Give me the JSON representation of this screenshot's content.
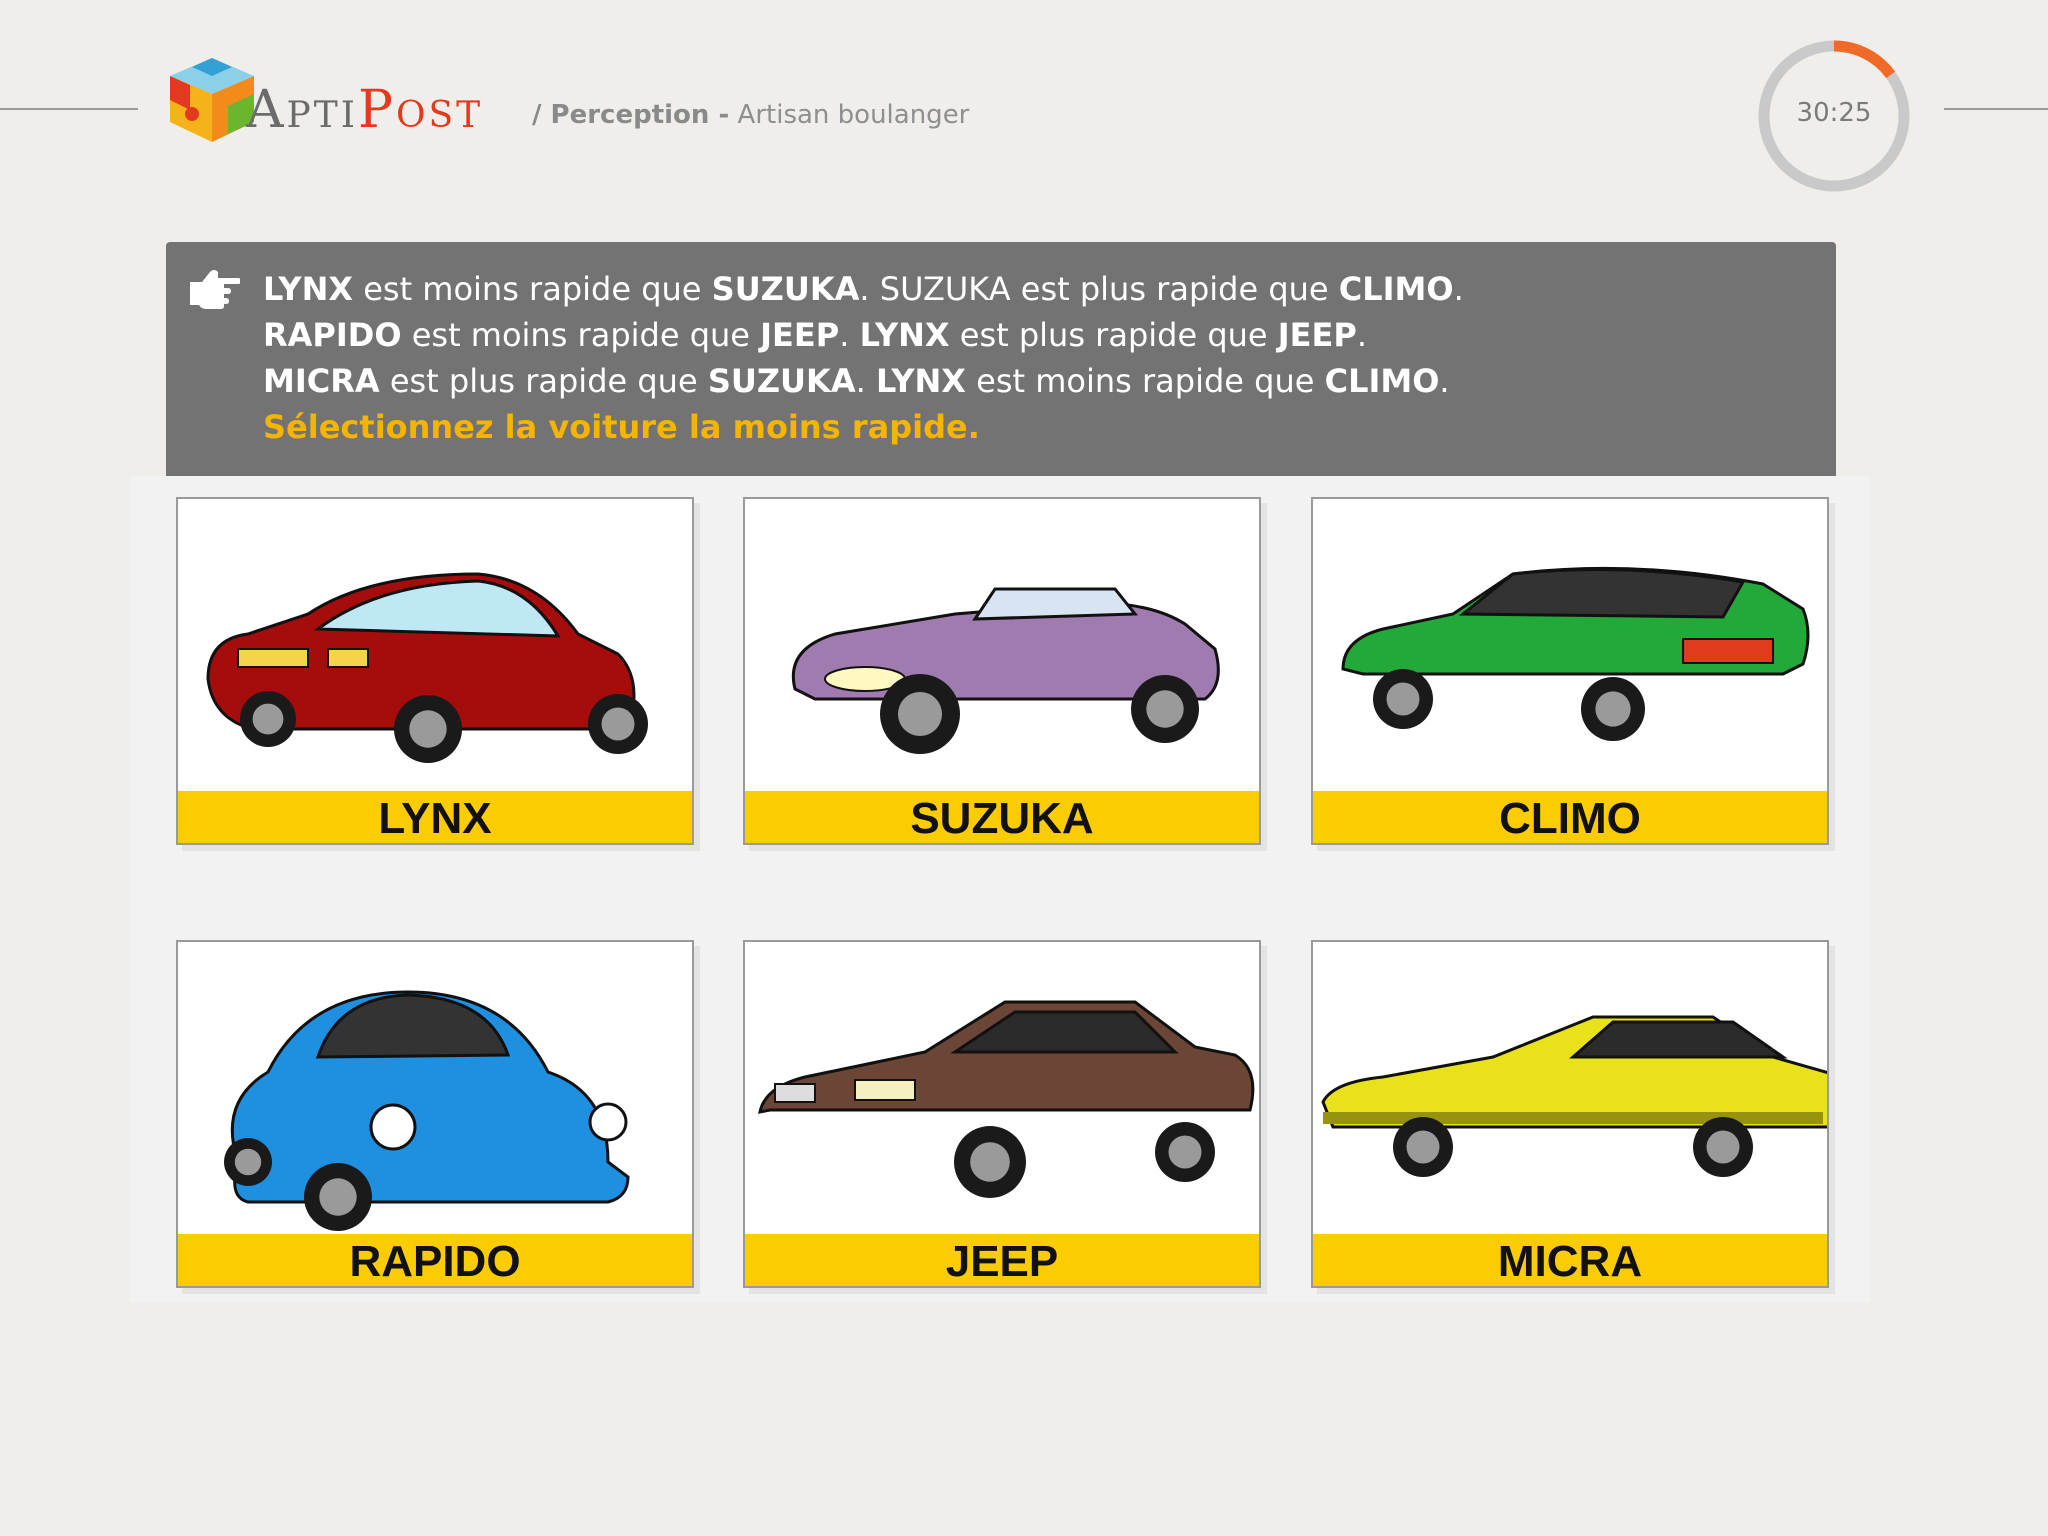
{
  "header": {
    "brand_part1": "Apti",
    "brand_part2": "Post",
    "breadcrumb_section": "/ Perception -",
    "breadcrumb_page": "Artisan boulanger",
    "timer": "30:25",
    "timer_remaining_fraction": 0.15
  },
  "instructions": {
    "line1": [
      {
        "t": "LYNX",
        "b": true
      },
      {
        "t": " est moins rapide que ",
        "b": false
      },
      {
        "t": "SUZUKA",
        "b": true
      },
      {
        "t": ". SUZUKA est plus rapide que ",
        "b": false
      },
      {
        "t": "CLIMO",
        "b": true
      },
      {
        "t": ".",
        "b": false
      }
    ],
    "line2": [
      {
        "t": "RAPIDO",
        "b": true
      },
      {
        "t": " est moins rapide que ",
        "b": false
      },
      {
        "t": "JEEP",
        "b": true
      },
      {
        "t": ". ",
        "b": false
      },
      {
        "t": "LYNX",
        "b": true
      },
      {
        "t": " est plus rapide que ",
        "b": false
      },
      {
        "t": "JEEP",
        "b": true
      },
      {
        "t": ".",
        "b": false
      }
    ],
    "line3": [
      {
        "t": "MICRA",
        "b": true
      },
      {
        "t": " est plus rapide que ",
        "b": false
      },
      {
        "t": "SUZUKA",
        "b": true
      },
      {
        "t": ". ",
        "b": false
      },
      {
        "t": "LYNX",
        "b": true
      },
      {
        "t": " est moins rapide que ",
        "b": false
      },
      {
        "t": "CLIMO",
        "b": true
      },
      {
        "t": ".",
        "b": false
      }
    ],
    "question": "Sélectionnez la voiture la moins rapide."
  },
  "cars": [
    {
      "label": "LYNX",
      "color": "#a50d0d",
      "style": "sedan-rear"
    },
    {
      "label": "SUZUKA",
      "color": "#a07bb0",
      "style": "convertible"
    },
    {
      "label": "CLIMO",
      "color": "#23a83a",
      "style": "hatch"
    },
    {
      "label": "RAPIDO",
      "color": "#1f8fe0",
      "style": "beetle"
    },
    {
      "label": "JEEP",
      "color": "#6b4535",
      "style": "coupe"
    },
    {
      "label": "MICRA",
      "color": "#e9e21a",
      "style": "coupe-long"
    }
  ],
  "colors": {
    "accent_orange": "#f06a28",
    "question_yellow": "#f5b400",
    "label_yellow": "#fccc02"
  }
}
